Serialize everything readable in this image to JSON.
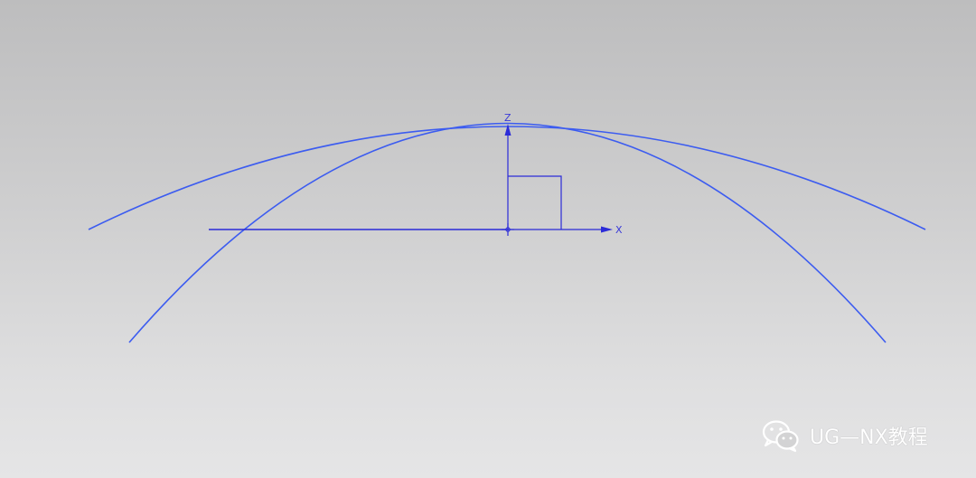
{
  "viewport": {
    "background_top": "#bdbdbe",
    "background_bottom": "#e5e5e6",
    "curve_color": "#3c5cf0",
    "axis_color": "#2b2bd8"
  },
  "triad": {
    "x_label": "X",
    "z_label": "Z"
  },
  "watermark": {
    "icon": "wechat-icon",
    "text": "UG—NX教程"
  }
}
